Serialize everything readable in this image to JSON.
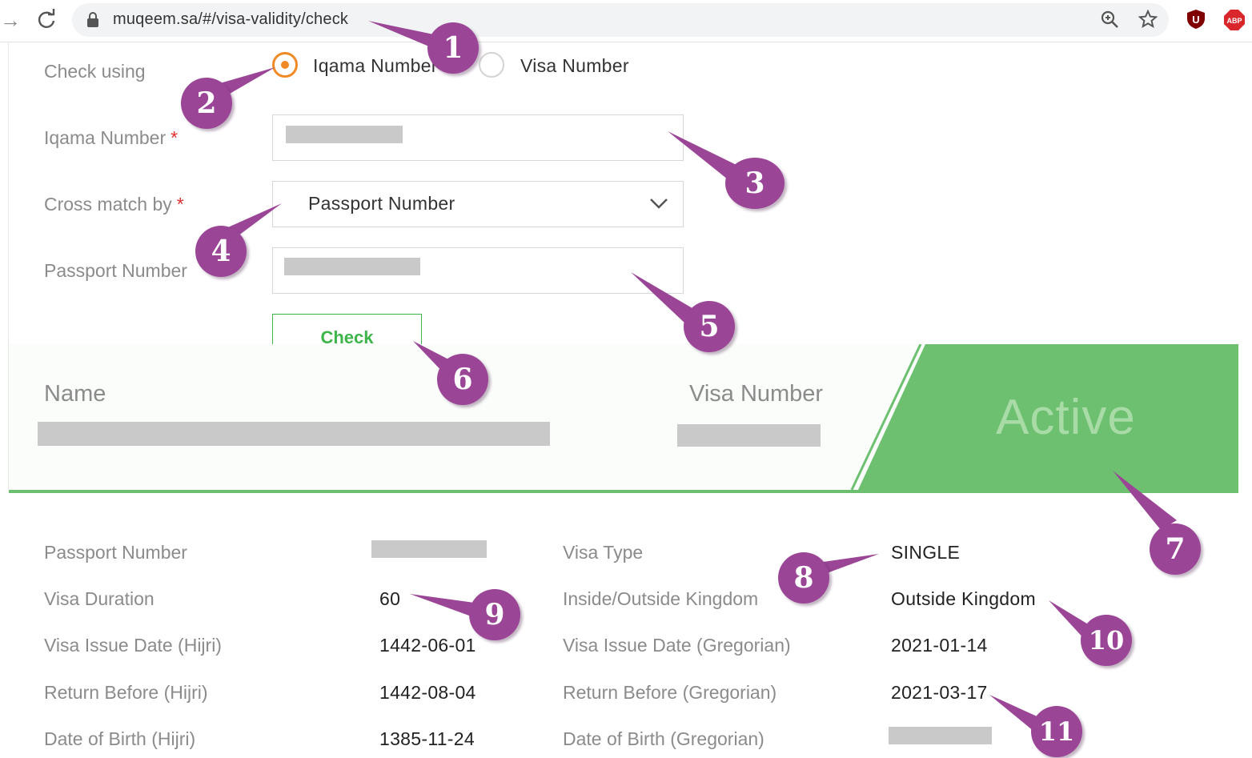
{
  "browser": {
    "url": "muqeem.sa/#/visa-validity/check",
    "icons": [
      "forward-icon",
      "reload-icon",
      "lock-icon",
      "zoom-icon",
      "star-icon",
      "ublock-icon",
      "adblock-plus-icon"
    ],
    "ext_u_label": "U",
    "ext_abp_label": "ABP"
  },
  "form": {
    "check_using_label": "Check using",
    "radio_iqama_label": "Iqama Number",
    "radio_visa_label": "Visa Number",
    "selected_radio": "Iqama Number",
    "iqama_label": "Iqama Number",
    "cross_match_label": "Cross match by",
    "cross_match_value": "Passport Number",
    "passport_label": "Passport Number",
    "required_mark": "*",
    "check_button": "Check"
  },
  "result": {
    "name_label": "Name",
    "visa_number_label": "Visa Number",
    "status": "Active",
    "status_color": "#6cc070"
  },
  "details": {
    "left": [
      {
        "label": "Passport Number",
        "value": ""
      },
      {
        "label": "Visa Duration",
        "value": "60"
      },
      {
        "label": "Visa Issue Date (Hijri)",
        "value": "1442-06-01"
      },
      {
        "label": "Return Before (Hijri)",
        "value": "1442-08-04"
      },
      {
        "label": "Date of Birth (Hijri)",
        "value": "1385-11-24"
      }
    ],
    "right": [
      {
        "label": "Visa Type",
        "value": "SINGLE"
      },
      {
        "label": "Inside/Outside Kingdom",
        "value": "Outside Kingdom"
      },
      {
        "label": "Visa Issue Date (Gregorian)",
        "value": "2021-01-14"
      },
      {
        "label": "Return Before (Gregorian)",
        "value": "2021-03-17"
      },
      {
        "label": "Date of Birth (Gregorian)",
        "value": ""
      }
    ]
  },
  "annotations": {
    "color": "#9b4597",
    "labels": [
      "1",
      "2",
      "3",
      "4",
      "5",
      "6",
      "7",
      "8",
      "9",
      "10",
      "11"
    ]
  }
}
